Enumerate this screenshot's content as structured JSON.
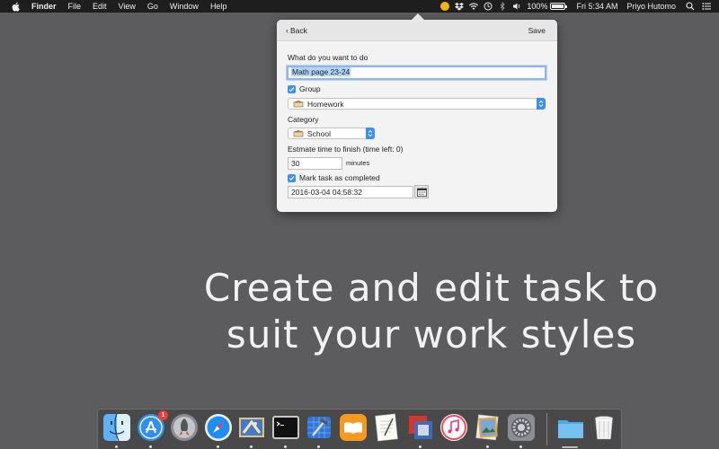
{
  "menubar": {
    "app_name": "Finder",
    "items": [
      "File",
      "Edit",
      "View",
      "Go",
      "Window",
      "Help"
    ],
    "battery_text": "100%",
    "clock": "Fri 5:34 AM",
    "user": "Priyo Hutomo"
  },
  "popover": {
    "back_label": "Back",
    "save_label": "Save",
    "task_label": "What do you want to do",
    "task_value": "Math page 23-24",
    "group_label": "Group",
    "group_value": "Homework",
    "category_label": "Category",
    "category_value": "School",
    "estimate_label": "Estmate time to finish (time left: 0)",
    "estimate_value": "30",
    "estimate_unit": "minutes",
    "completed_label": "Mark task as completed",
    "completed_datetime": "2016-03-04 04:58:32"
  },
  "headline": {
    "line1": "Create and edit task to",
    "line2": "suit your work styles"
  },
  "dock": {
    "app_store_badge": "1",
    "apps": [
      "finder-icon",
      "app-store-icon",
      "launchpad-icon",
      "safari-icon",
      "mail-icon",
      "terminal-icon",
      "xcode-icon",
      "ibooks-icon",
      "textedit-icon",
      "parallels-icon",
      "itunes-icon",
      "preview-icon",
      "system-preferences-icon",
      "downloads-folder-icon",
      "trash-icon"
    ]
  },
  "colors": {
    "desktop": "#5c5c5e",
    "accent": "#3d8ef7",
    "selection": "#b3d3fb"
  }
}
